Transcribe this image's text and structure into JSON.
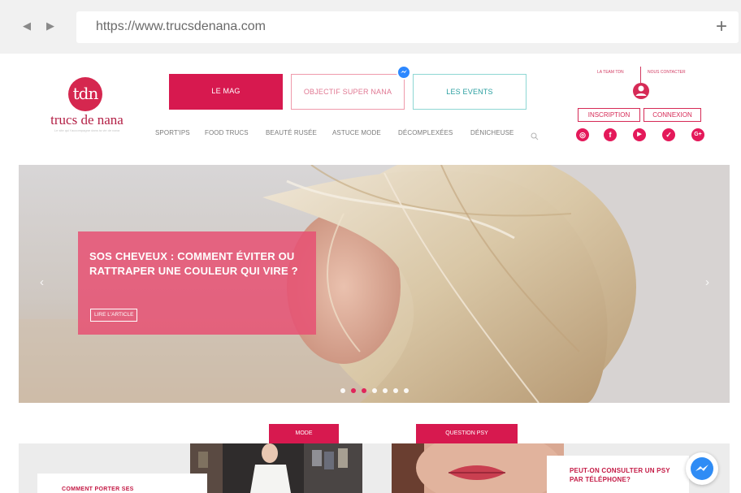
{
  "browser": {
    "url": "https://www.trucsdenana.com",
    "back_icon": "back-arrow-icon",
    "forward_icon": "forward-arrow-icon",
    "newtab_label": "+"
  },
  "header": {
    "logo_mark": "tdn",
    "logo_name": "trucs de nana",
    "logo_tagline": "Le site qui t'accompagne dans ta vie de nana",
    "tabs": [
      "LE MAG",
      "OBJECTIF SUPER NANA",
      "LES EVENTS"
    ],
    "categories": [
      "SPORT'IPS",
      "FOOD TRUCS",
      "BEAUTÉ RUSÉE",
      "ASTUCE MODE",
      "DÉCOMPLEXÉES",
      "DÉNICHEUSE"
    ],
    "top_links": [
      "LA TEAM TDN",
      "NOUS CONTACTER"
    ],
    "auth": {
      "signup": "INSCRIPTION",
      "login": "CONNEXION"
    },
    "social": [
      {
        "name": "instagram-icon",
        "glyph": "◎"
      },
      {
        "name": "facebook-icon",
        "glyph": "f"
      },
      {
        "name": "youtube-icon",
        "glyph": "▶"
      },
      {
        "name": "twitter-icon",
        "glyph": "✓"
      },
      {
        "name": "google-plus-icon",
        "glyph": "G+"
      }
    ]
  },
  "hero": {
    "title": "SOS CHEVEUX : COMMENT ÉVITER OU RATTRAPER UNE COULEUR QUI VIRE ?",
    "cta": "LIRE L'ARTICLE",
    "prev": "‹",
    "next": "›",
    "slide_count": 7,
    "active_slides": [
      1,
      2
    ]
  },
  "cards": [
    {
      "tag": "MODE",
      "title": "COMMENT PORTER SES"
    },
    {
      "tag": "QUESTION PSY",
      "title": "PEUT-ON CONSULTER UN PSY PAR TÉLÉPHONE?"
    }
  ],
  "colors": {
    "brand": "#d7194f",
    "teal": "#2a9fa0",
    "messenger": "#2f8cf5"
  }
}
